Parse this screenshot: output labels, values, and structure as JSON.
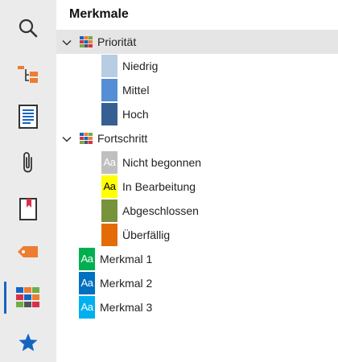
{
  "rail": {
    "items": [
      {
        "icon": "search-icon"
      },
      {
        "icon": "hierarchy-icon"
      },
      {
        "icon": "document-icon"
      },
      {
        "icon": "paperclip-icon"
      },
      {
        "icon": "bookmark-icon"
      },
      {
        "icon": "tag-icon"
      },
      {
        "icon": "attributes-grid-icon",
        "active": true
      },
      {
        "icon": "star-icon"
      }
    ]
  },
  "panel": {
    "title": "Merkmale",
    "groups": [
      {
        "label": "Priorität",
        "expanded": true,
        "selected": true,
        "items": [
          {
            "label": "Niedrig",
            "color": "#b8cce4",
            "glyph": ""
          },
          {
            "label": "Mittel",
            "color": "#558ed5",
            "glyph": ""
          },
          {
            "label": "Hoch",
            "color": "#376092",
            "glyph": ""
          }
        ]
      },
      {
        "label": "Fortschritt",
        "expanded": true,
        "selected": false,
        "items": [
          {
            "label": "Nicht begonnen",
            "color": "#bfbfbf",
            "glyph": "Aa",
            "glyph_color": "#ffffff"
          },
          {
            "label": "In Bearbeitung",
            "color": "#ffff00",
            "glyph": "Aa",
            "glyph_color": "#000000"
          },
          {
            "label": "Abgeschlossen",
            "color": "#77933c",
            "glyph": ""
          },
          {
            "label": "Überfällig",
            "color": "#e36c09",
            "glyph": ""
          }
        ]
      }
    ],
    "standalone": [
      {
        "label": "Merkmal 1",
        "color": "#00b050",
        "glyph": "Aa",
        "glyph_color": "#ffffff"
      },
      {
        "label": "Merkmal 2",
        "color": "#0070c0",
        "glyph": "Aa",
        "glyph_color": "#ffffff"
      },
      {
        "label": "Merkmal 3",
        "color": "#00b0f0",
        "glyph": "Aa",
        "glyph_color": "#ffffff"
      }
    ]
  },
  "colors": {
    "accent": "#1565c0",
    "rail_bg": "#ebebeb",
    "selected_bg": "#e5e5e5"
  }
}
